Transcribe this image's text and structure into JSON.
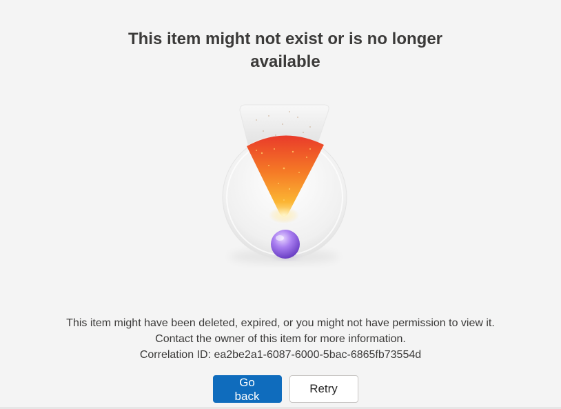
{
  "error_page": {
    "title": "This item might not exist or is no longer available",
    "illustration_icon": "exclamation-illustration",
    "message_lines": [
      "This item might have been deleted, expired, or you might not have permission to view it.",
      "Contact the owner of this item for more information.",
      "Correlation ID: ea2be2a1-6087-6000-5bac-6865fb73554d"
    ],
    "buttons": {
      "go_back": "Go back",
      "retry": "Retry"
    },
    "colors": {
      "primary": "#0f6cbd",
      "background": "#f4f4f4",
      "accent_orange": "#f05a28",
      "accent_purple": "#7a55d8"
    }
  }
}
